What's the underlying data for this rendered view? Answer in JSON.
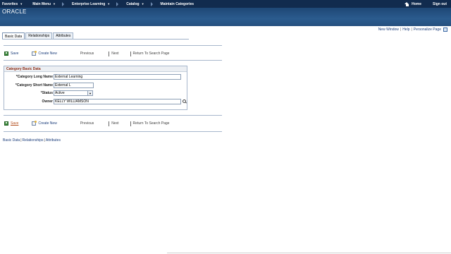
{
  "topnav": {
    "favorites": "Favorites",
    "main_menu": "Main Menu",
    "breadcrumb": [
      "Enterprise Learning",
      "Catalog",
      "Maintain Categories"
    ],
    "home": "Home",
    "sign_out": "Sign out"
  },
  "banner": {
    "logo": "ORACLE"
  },
  "pagelinks": {
    "new_window": "New Window",
    "help": "Help",
    "personalize": "Personalize Page"
  },
  "tabs": [
    "Basic Data",
    "Relationships",
    "Attributes"
  ],
  "toolbar": {
    "save": "Save",
    "create_new": "Create New",
    "previous": "Previous",
    "next": "Next",
    "return_to_search": "Return To Search Page"
  },
  "group": {
    "title": "Category Basic Data",
    "fields": {
      "long_name_label": "*Category Long Name",
      "long_name_value": "External Learning",
      "short_name_label": "*Category Short Name",
      "short_name_value": "External L",
      "status_label": "*Status",
      "status_value": "Active",
      "owner_label": "Owner",
      "owner_value": "KELLY WILLIAMSON"
    }
  },
  "bottomlinks": [
    "Basic Data",
    "Relationships",
    "Attributes"
  ]
}
